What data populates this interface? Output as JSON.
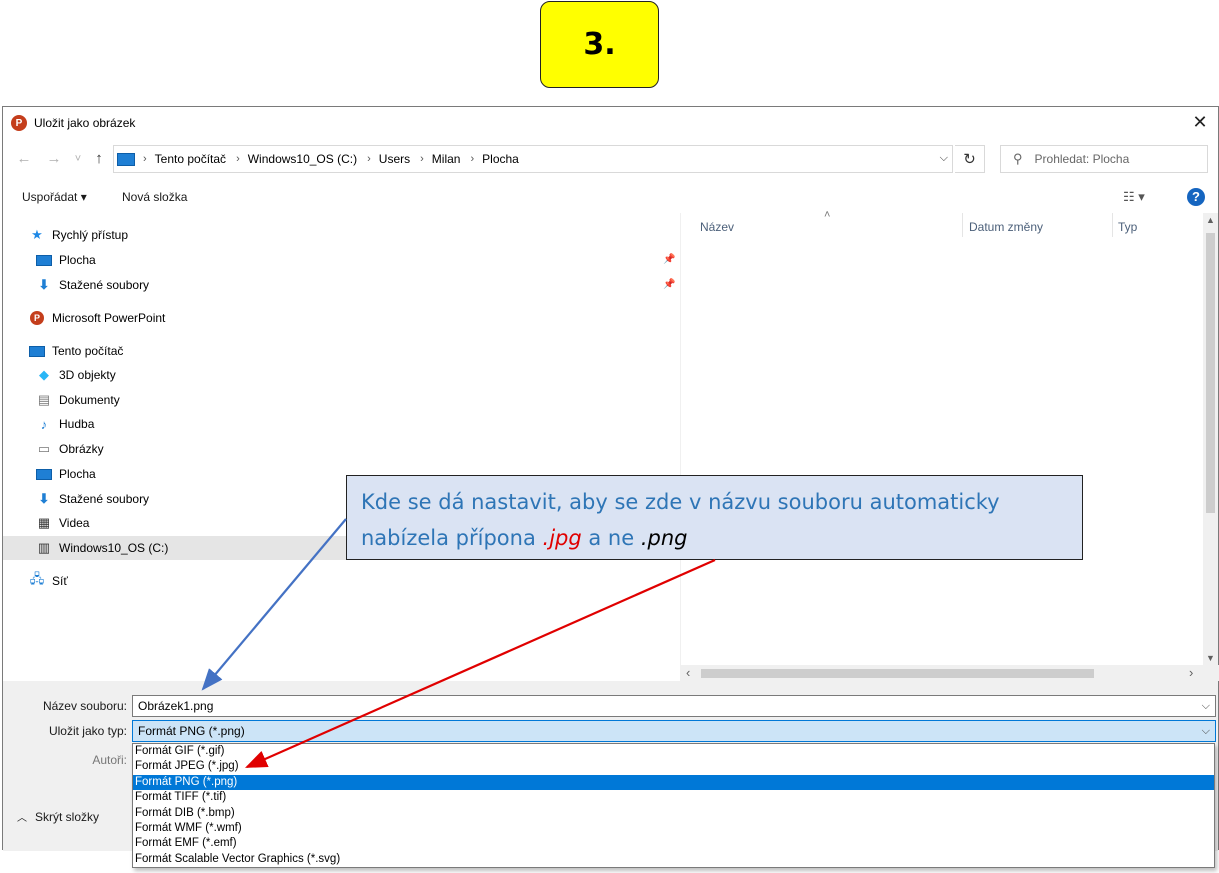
{
  "badge": {
    "text": "3."
  },
  "dialog": {
    "title": "Uložit jako obrázek",
    "app_icon": "P",
    "close_icon": "✕"
  },
  "navbar": {
    "back_icon": "←",
    "forward_icon": "→",
    "recent_icon": "˅",
    "up_icon": "↑",
    "breadcrumb": [
      "Tento počítač",
      "Windows10_OS (C:)",
      "Users",
      "Milan",
      "Plocha"
    ],
    "refresh_icon": "↻",
    "search_placeholder": "Prohledat: Plocha"
  },
  "toolbar": {
    "organize_label": "Uspořádat ▾",
    "new_folder_label": "Nová složka",
    "view_icon": "☷ ▾",
    "help_icon": "?"
  },
  "sidebar": {
    "quick_access": "Rychlý přístup",
    "items": [
      {
        "label": "Plocha",
        "icon": "desktop-icon"
      },
      {
        "label": "Stažené soubory",
        "icon": "download-icon"
      },
      {
        "label": "Microsoft PowerPoint",
        "icon": "powerpoint-icon"
      },
      {
        "label": "Tento počítač",
        "icon": "computer-icon"
      },
      {
        "label": "3D objekty",
        "icon": "cube-icon"
      },
      {
        "label": "Dokumenty",
        "icon": "document-icon"
      },
      {
        "label": "Hudba",
        "icon": "music-icon"
      },
      {
        "label": "Obrázky",
        "icon": "pictures-icon"
      },
      {
        "label": "Plocha",
        "icon": "desktop-icon"
      },
      {
        "label": "Stažené soubory",
        "icon": "download-icon"
      },
      {
        "label": "Videa",
        "icon": "video-icon"
      },
      {
        "label": "Windows10_OS (C:)",
        "icon": "drive-icon"
      },
      {
        "label": "Síť",
        "icon": "network-icon"
      }
    ]
  },
  "file_list": {
    "columns": [
      "Název",
      "Datum změny",
      "Typ"
    ]
  },
  "form": {
    "filename_label": "Název souboru:",
    "filename_value": "Obrázek1.png",
    "type_label": "Uložit jako typ:",
    "type_value": "Formát PNG (*.png)",
    "authors_label": "Autoři:",
    "hide_folders": "Skrýt složky"
  },
  "type_options": [
    "Formát GIF (*.gif)",
    "Formát JPEG (*.jpg)",
    "Formát PNG (*.png)",
    "Formát TIFF (*.tif)",
    "Formát DIB (*.bmp)",
    "Formát WMF (*.wmf)",
    "Formát EMF (*.emf)",
    "Formát Scalable Vector Graphics (*.svg)"
  ],
  "type_selected_index": 2,
  "callout": {
    "line1": "Kde se dá nastavit, aby se zde v názvu souboru automaticky",
    "line2_prefix": "nabízela přípona",
    "ext_jpg": ".jpg",
    "line2_mid": "a ne",
    "ext_png": ".png"
  },
  "colors": {
    "badge_bg": "#ffff00",
    "callout_bg": "#dae3f3",
    "callout_text": "#2e75b6",
    "arrow_blue": "#4472c4",
    "arrow_red": "#e00000",
    "selection": "#0078d7"
  }
}
